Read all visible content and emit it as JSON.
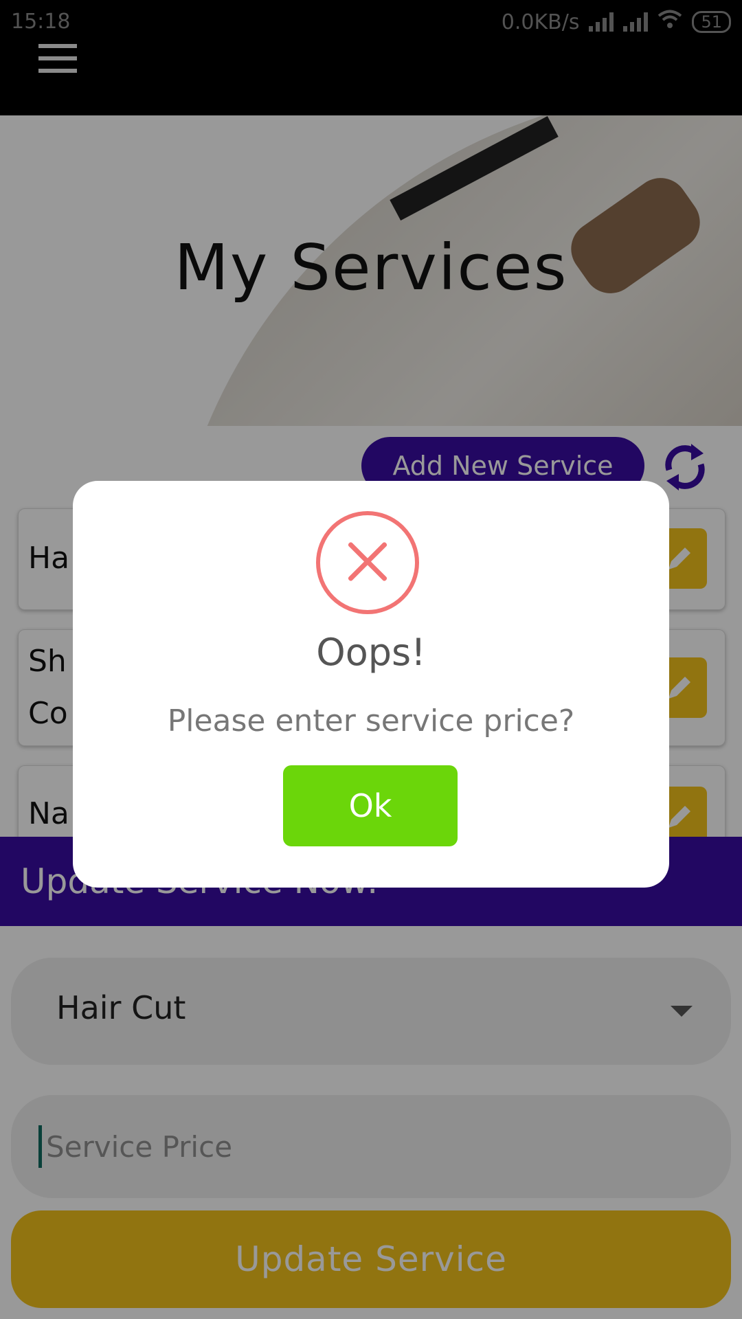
{
  "status_bar": {
    "time": "15:18",
    "network_speed": "0.0KB/s",
    "battery": "51"
  },
  "header": {
    "title": "My Services"
  },
  "actions": {
    "add_service_label": "Add New Service"
  },
  "services": [
    {
      "name": "Ha"
    },
    {
      "name_line1": "Sh",
      "name_line2": "Co"
    },
    {
      "name": "Na"
    }
  ],
  "update_section": {
    "title": "Update Service Now:",
    "selected_service": "Hair Cut",
    "price_placeholder": "Service Price",
    "submit_label": "Update Service"
  },
  "dialog": {
    "title": "Oops!",
    "message": "Please enter service price?",
    "ok_label": "Ok"
  },
  "colors": {
    "primary": "#3a0ca3",
    "accent": "#f2c21b",
    "error": "#f27474",
    "ok": "#6bd60a"
  }
}
